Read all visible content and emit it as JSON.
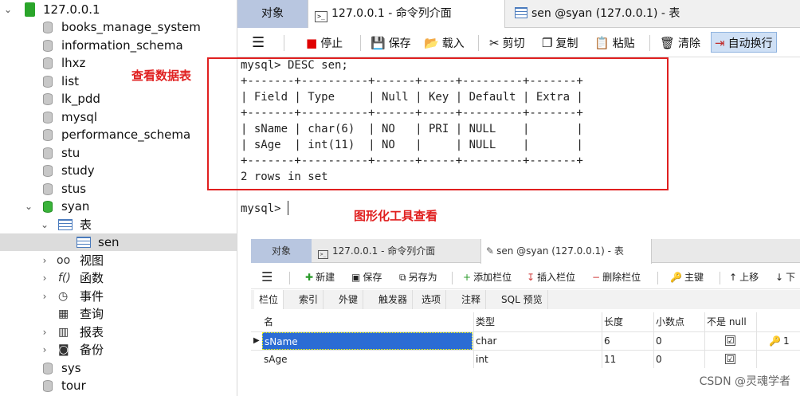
{
  "tree": {
    "connection": "127.0.0.1",
    "databases": [
      "books_manage_system",
      "information_schema",
      "lhxz",
      "list",
      "lk_pdd",
      "mysql",
      "performance_schema",
      "stu",
      "study",
      "stus"
    ],
    "open_db": "syan",
    "tables_group": "表",
    "selected_table": "sen",
    "groups": [
      "视图",
      "函数",
      "事件",
      "查询",
      "报表",
      "备份"
    ],
    "databases_after": [
      "sys",
      "tour"
    ]
  },
  "tabs": {
    "objects": "对象",
    "console": "127.0.0.1 - 命令列介面",
    "table": "sen @syan (127.0.0.1) - 表"
  },
  "toolbar": {
    "menu": "☰",
    "stop": "停止",
    "save": "保存",
    "load": "载入",
    "cut": "剪切",
    "copy": "复制",
    "paste": "粘贴",
    "clear": "清除",
    "wrap": "自动换行"
  },
  "console": {
    "lines": [
      "mysql> DESC sen;",
      "+-------+----------+------+-----+---------+-------+",
      "| Field | Type     | Null | Key | Default | Extra |",
      "+-------+----------+------+-----+---------+-------+",
      "| sName | char(6)  | NO   | PRI | NULL    |       |",
      "| sAge  | int(11)  | NO   |     | NULL    |       |",
      "+-------+----------+------+-----+---------+-------+",
      "2 rows in set"
    ],
    "prompt": "mysql> "
  },
  "annotations": {
    "view_table": "查看数据表",
    "gui_tool": "图形化工具查看"
  },
  "designer": {
    "tabs": {
      "objects": "对象",
      "console": "127.0.0.1 - 命令列介面",
      "table": "sen @syan (127.0.0.1) - 表"
    },
    "toolbar": {
      "new": "新建",
      "save": "保存",
      "save_as": "另存为",
      "add_field": "添加栏位",
      "insert_field": "插入栏位",
      "delete_field": "删除栏位",
      "primary_key": "主键",
      "move_up": "上移",
      "move_down": "下"
    },
    "subtabs": [
      "栏位",
      "索引",
      "外键",
      "触发器",
      "选项",
      "注释",
      "SQL 预览"
    ],
    "columns": [
      "名",
      "类型",
      "长度",
      "小数点",
      "不是 null"
    ],
    "rows": [
      {
        "name": "sName",
        "type": "char",
        "length": "6",
        "decimals": "0",
        "not_null": "☑",
        "key": "1"
      },
      {
        "name": "sAge",
        "type": "int",
        "length": "11",
        "decimals": "0",
        "not_null": "☑",
        "key": ""
      }
    ]
  },
  "watermark": "CSDN @灵魂学者"
}
